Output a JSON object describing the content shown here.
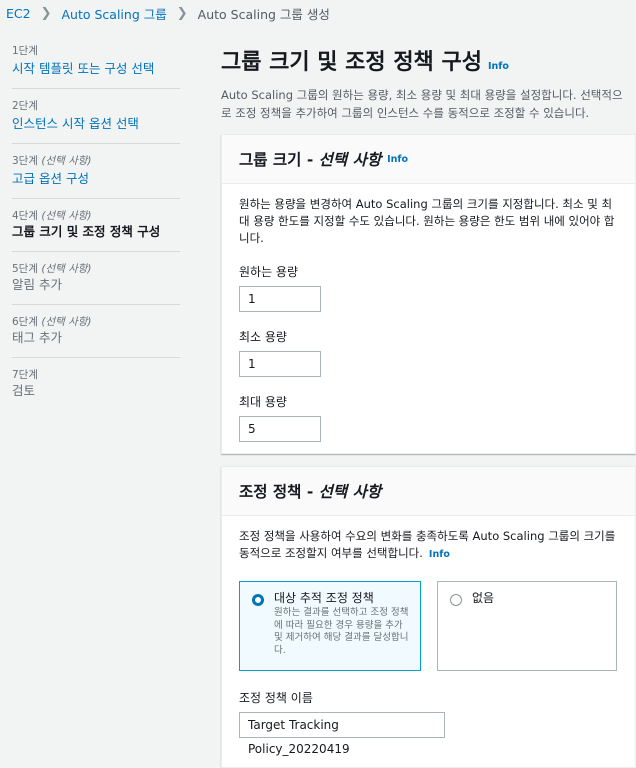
{
  "breadcrumb": {
    "items": [
      "EC2",
      "Auto Scaling 그룹",
      "Auto Scaling 그룹 생성"
    ]
  },
  "steps": [
    {
      "num": "1단계",
      "optional": "",
      "title": "시작 템플릿 또는 구성 선택",
      "state": "link"
    },
    {
      "num": "2단계",
      "optional": "",
      "title": "인스턴스 시작 옵션 선택",
      "state": "link"
    },
    {
      "num": "3단계",
      "optional": "(선택 사항)",
      "title": "고급 옵션 구성",
      "state": "link"
    },
    {
      "num": "4단계",
      "optional": "(선택 사항)",
      "title": "그룹 크기 및 조정 정책 구성",
      "state": "current"
    },
    {
      "num": "5단계",
      "optional": "(선택 사항)",
      "title": "알림 추가",
      "state": "disabled"
    },
    {
      "num": "6단계",
      "optional": "(선택 사항)",
      "title": "태그 추가",
      "state": "disabled"
    },
    {
      "num": "7단계",
      "optional": "",
      "title": "검토",
      "state": "disabled"
    }
  ],
  "page": {
    "title": "그룹 크기 및 조정 정책 구성",
    "info": "Info",
    "description": "Auto Scaling 그룹의 원하는 용량, 최소 용량 및 최대 용량을 설정합니다. 선택적으로 조정 정책을 추가하여 그룹의 인스턴스 수를 동적으로 조정할 수 있습니다."
  },
  "group_size": {
    "title": "그룹 크기 - ",
    "title_optional": "선택 사항",
    "info": "Info",
    "help": "원하는 용량을 변경하여 Auto Scaling 그룹의 크기를 지정합니다. 최소 및 최대 용량 한도를 지정할 수도 있습니다. 원하는 용량은 한도 범위 내에 있어야 합니다.",
    "desired_label": "원하는 용량",
    "desired_value": "1",
    "min_label": "최소 용량",
    "min_value": "1",
    "max_label": "최대 용량",
    "max_value": "5"
  },
  "scaling": {
    "title": "조정 정책 - ",
    "title_optional": "선택 사항",
    "help": "조정 정책을 사용하여 수요의 변화를 충족하도록 Auto Scaling 그룹의 크기를 동적으로 조정할지 여부를 선택합니다.",
    "info": "Info",
    "option1_title": "대상 추적 조정 정책",
    "option1_desc": "원하는 결과를 선택하고 조정 정책에 따라 필요한 경우 용량을 추가 및 제거하여 해당 결과를 달성합니다.",
    "option2_title": "없음",
    "policy_name_label": "조정 정책 이름",
    "policy_name_value": "Target Tracking Policy_20220419"
  },
  "colors": {
    "link": "#0073bb",
    "selected_border": "#00a1c9",
    "selected_bg": "#f1faff"
  }
}
